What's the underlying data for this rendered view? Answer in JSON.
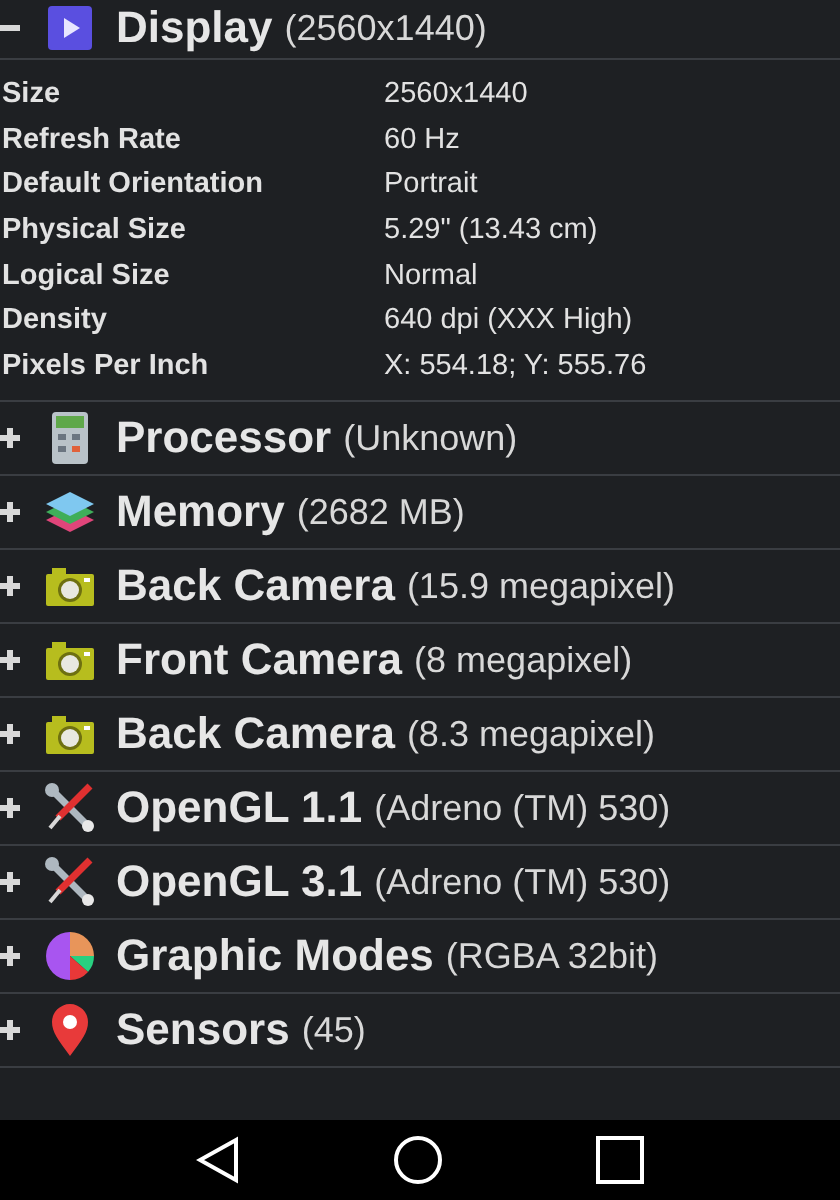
{
  "sections": [
    {
      "title": "Display",
      "detail": "(2560x1440)",
      "kind": "display",
      "expanded": true,
      "properties": [
        {
          "label": "Size",
          "value": "2560x1440"
        },
        {
          "label": "Refresh Rate",
          "value": "60 Hz"
        },
        {
          "label": "Default Orientation",
          "value": "Portrait"
        },
        {
          "label": "Physical Size",
          "value": "5.29\" (13.43 cm)"
        },
        {
          "label": "Logical Size",
          "value": "Normal"
        },
        {
          "label": "Density",
          "value": "640 dpi (XXX High)"
        },
        {
          "label": "Pixels Per Inch",
          "value": "X: 554.18; Y: 555.76"
        }
      ]
    },
    {
      "title": "Processor",
      "detail": "(Unknown)",
      "kind": "calculator",
      "expanded": false
    },
    {
      "title": "Memory",
      "detail": "(2682 MB)",
      "kind": "layers",
      "expanded": false
    },
    {
      "title": "Back Camera",
      "detail": "(15.9 megapixel)",
      "kind": "camera",
      "expanded": false
    },
    {
      "title": "Front Camera",
      "detail": "(8 megapixel)",
      "kind": "camera",
      "expanded": false
    },
    {
      "title": "Back Camera",
      "detail": "(8.3 megapixel)",
      "kind": "camera",
      "expanded": false
    },
    {
      "title": "OpenGL 1.1",
      "detail": "(Adreno (TM) 530)",
      "kind": "tools",
      "expanded": false
    },
    {
      "title": "OpenGL 3.1",
      "detail": "(Adreno (TM) 530)",
      "kind": "tools",
      "expanded": false
    },
    {
      "title": "Graphic Modes",
      "detail": "(RGBA 32bit)",
      "kind": "pie",
      "expanded": false
    },
    {
      "title": "Sensors",
      "detail": "(45)",
      "kind": "pin",
      "expanded": false
    }
  ]
}
